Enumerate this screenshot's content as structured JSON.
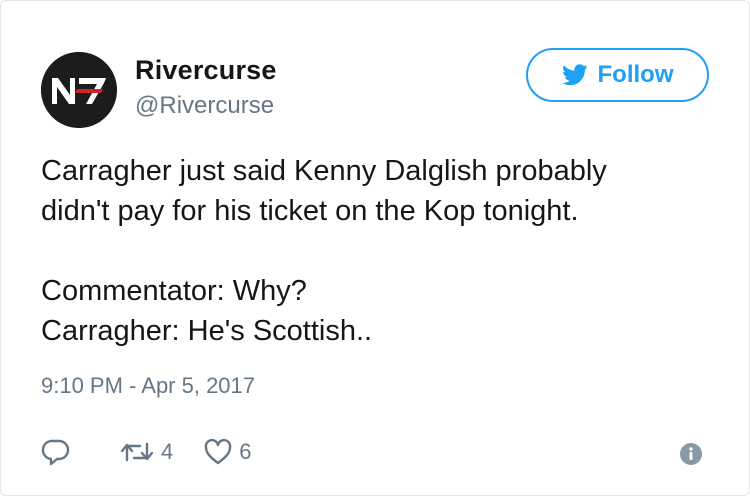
{
  "user": {
    "name": "Rivercurse",
    "handle": "@Rivercurse",
    "avatar_text": "N7"
  },
  "follow_button": {
    "label": "Follow",
    "icon": "twitter-bird-icon"
  },
  "tweet": {
    "lines": [
      "Carragher just said Kenny Dalglish probably",
      "didn't pay for his ticket on the Kop tonight.",
      "",
      "Commentator: Why?",
      "Carragher: He's Scottish.."
    ]
  },
  "timestamp": "9:10 PM - Apr 5, 2017",
  "actions": {
    "reply_icon": "reply-icon",
    "retweet_icon": "retweet-icon",
    "retweet_count": "4",
    "like_icon": "heart-icon",
    "like_count": "6",
    "info_icon": "info-icon"
  },
  "colors": {
    "accent": "#1da1f2",
    "secondary_text": "#657786",
    "border": "#e1e8ed",
    "avatar_red": "#d2232a"
  }
}
